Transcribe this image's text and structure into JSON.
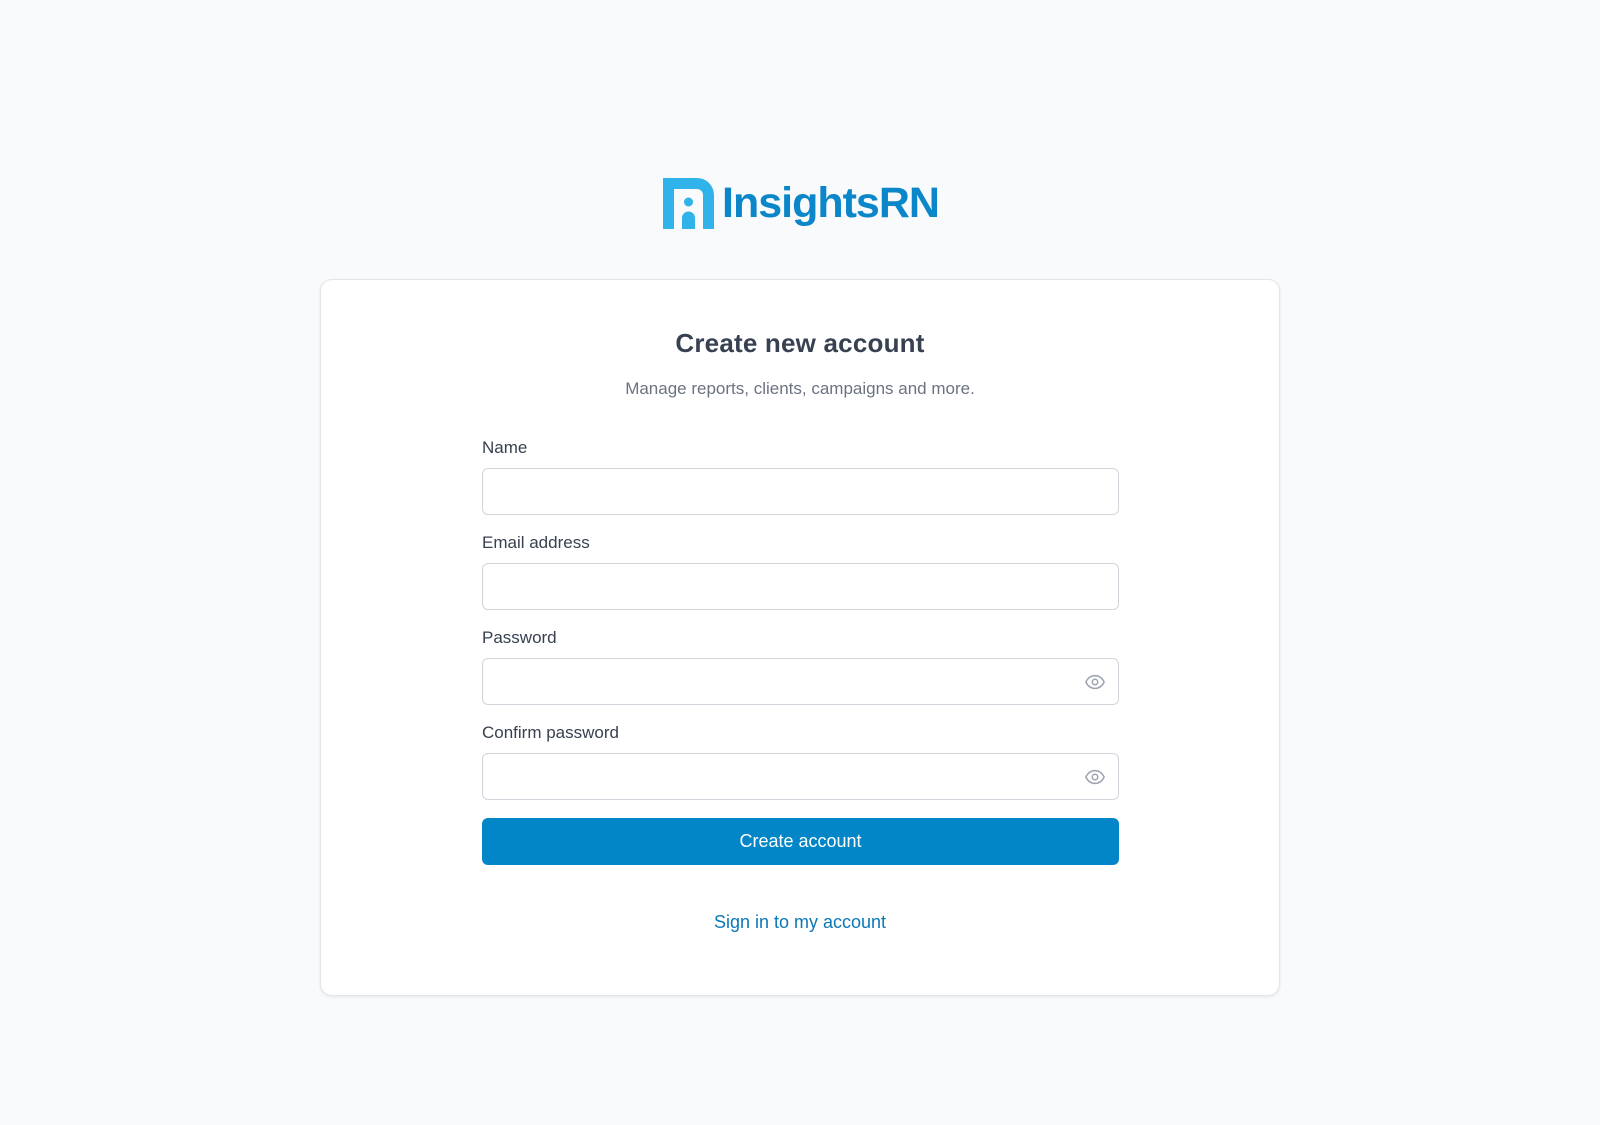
{
  "brand": {
    "name": "InsightsRN",
    "logo_icon": "insightsrn-logo-mark",
    "color": "#0a86c9"
  },
  "card": {
    "title": "Create new account",
    "subtitle": "Manage reports, clients, campaigns and more."
  },
  "form": {
    "name": {
      "label": "Name",
      "value": "",
      "placeholder": ""
    },
    "email": {
      "label": "Email address",
      "value": "",
      "placeholder": ""
    },
    "password": {
      "label": "Password",
      "value": "",
      "placeholder": "",
      "icon": "eye-icon"
    },
    "confirm_password": {
      "label": "Confirm password",
      "value": "",
      "placeholder": "",
      "icon": "eye-icon"
    },
    "submit_label": "Create account"
  },
  "footer": {
    "signin_link": "Sign in to my account"
  },
  "colors": {
    "primary": "#0386c8",
    "link": "#0b78b6",
    "background": "#f8fafc"
  }
}
